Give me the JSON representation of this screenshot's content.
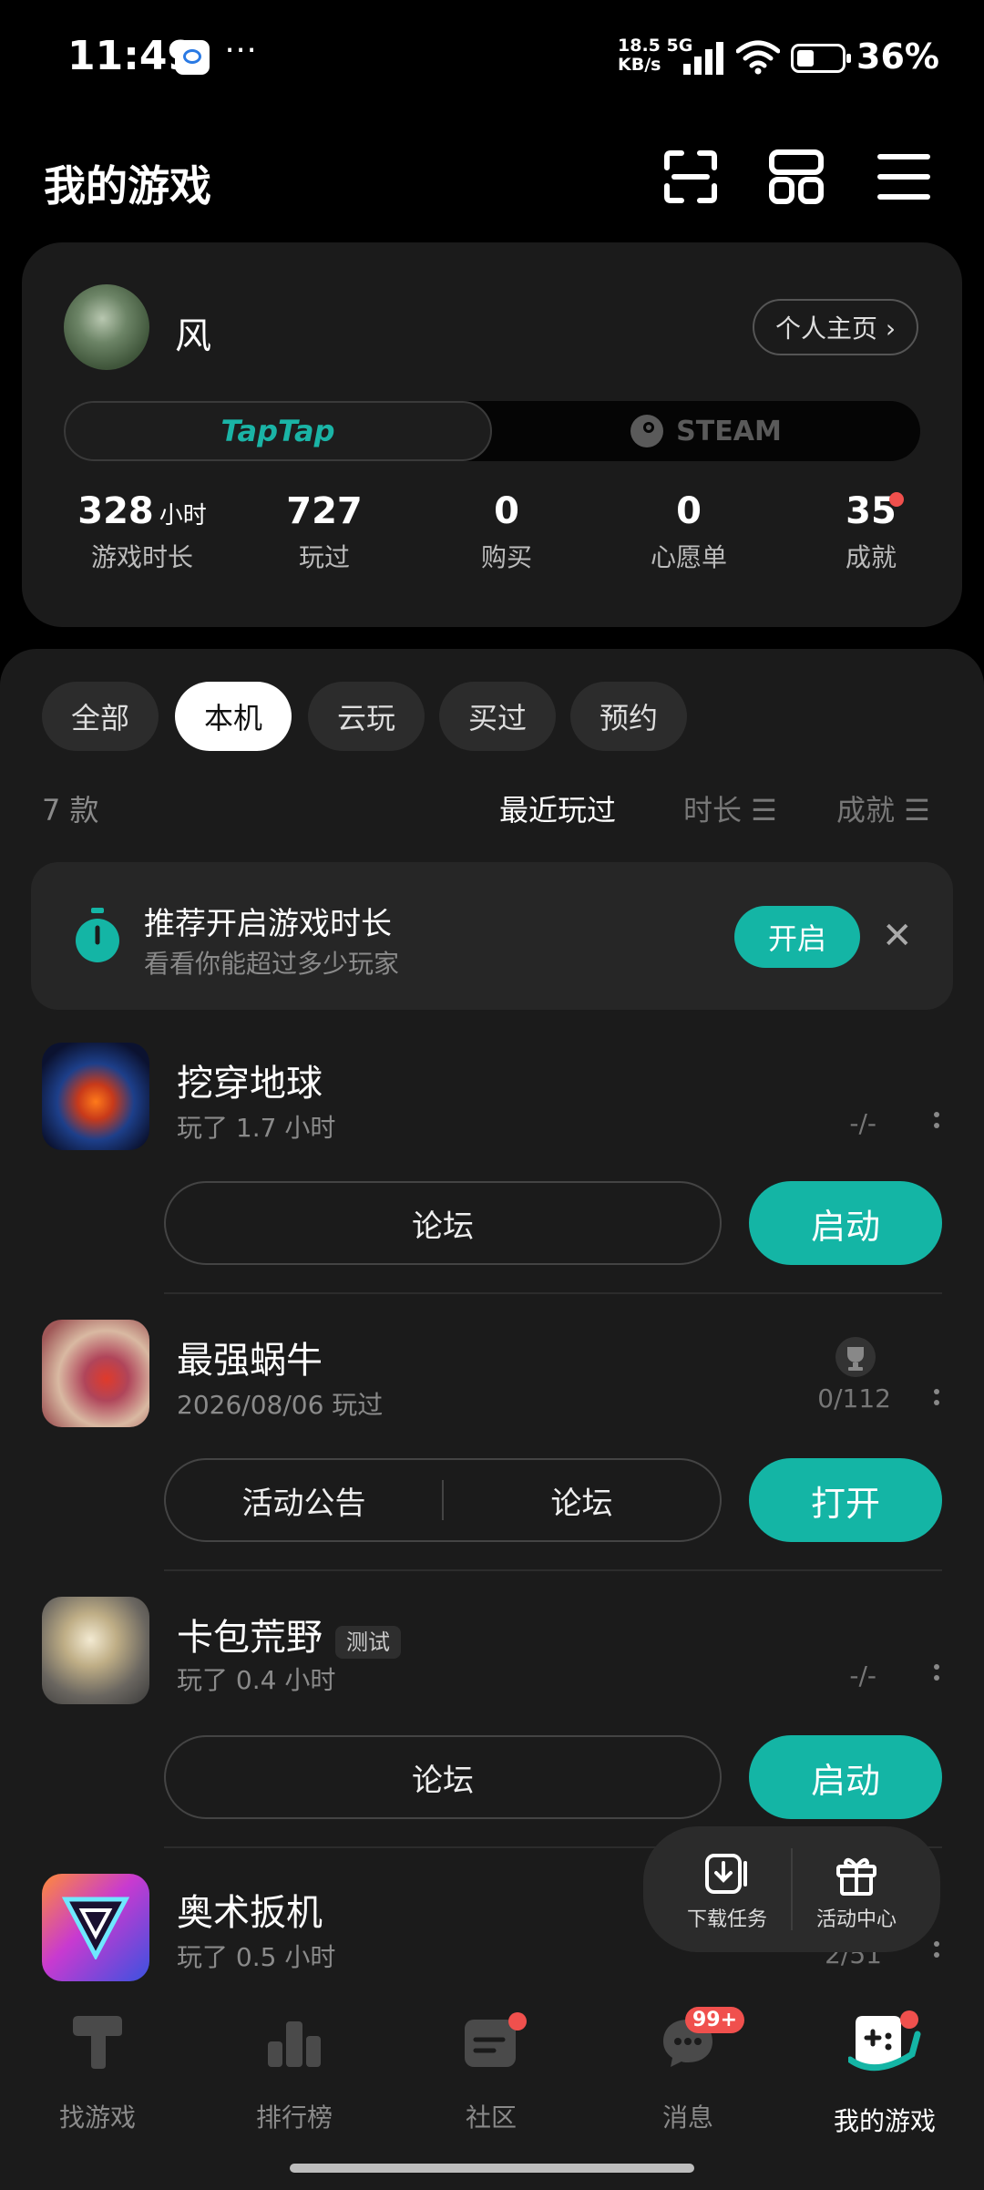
{
  "status_bar": {
    "time": "11:49",
    "net_speed": "18.5",
    "net_unit": "KB/s",
    "net_type": "5G",
    "battery": "36%"
  },
  "header": {
    "title": "我的游戏",
    "icons": [
      "scan-icon",
      "grid-icon",
      "menu-icon"
    ]
  },
  "profile": {
    "username": "风",
    "home_button": "个人主页 ›",
    "platforms": [
      "TapTap",
      "STEAM"
    ],
    "stats": [
      {
        "value": "328",
        "unit": "小时",
        "label": "游戏时长"
      },
      {
        "value": "727",
        "unit": "",
        "label": "玩过"
      },
      {
        "value": "0",
        "unit": "",
        "label": "购买"
      },
      {
        "value": "0",
        "unit": "",
        "label": "心愿单"
      },
      {
        "value": "35",
        "unit": "",
        "label": "成就"
      }
    ]
  },
  "filters": [
    "全部",
    "本机",
    "云玩",
    "买过",
    "预约"
  ],
  "active_filter": "本机",
  "list": {
    "count": "7 款",
    "sort_options": [
      "最近玩过",
      "时长 ☰",
      "成就 ☰"
    ]
  },
  "recommend": {
    "title": "推荐开启游戏时长",
    "subtitle": "看看你能超过多少玩家",
    "button": "开启",
    "close": "✕"
  },
  "games": [
    {
      "name": "挖穿地球",
      "sub": "玩了 1.7 小时",
      "stat": "-/-",
      "buttons": [
        "论坛"
      ],
      "action": "启动",
      "tag": ""
    },
    {
      "name": "最强蜗牛",
      "sub": "2026/08/06 玩过",
      "stat": "0/112",
      "buttons": [
        "活动公告",
        "论坛"
      ],
      "action": "打开",
      "tag": ""
    },
    {
      "name": "卡包荒野",
      "sub": "玩了 0.4 小时",
      "stat": "-/-",
      "buttons": [
        "论坛"
      ],
      "action": "启动",
      "tag": "测试"
    },
    {
      "name": "奥术扳机",
      "sub": "玩了 0.5 小时",
      "stat": "2/51",
      "buttons": [],
      "action": "",
      "tag": ""
    }
  ],
  "floating": {
    "download": "下载任务",
    "events": "活动中心"
  },
  "nav": [
    {
      "label": "找游戏",
      "badge": ""
    },
    {
      "label": "排行榜",
      "badge": ""
    },
    {
      "label": "社区",
      "badge": ""
    },
    {
      "label": "消息",
      "badge": "99+"
    },
    {
      "label": "我的游戏",
      "badge": ""
    }
  ],
  "colors": {
    "accent": "#14b5a5",
    "badge": "#f0504d",
    "background": "#000000",
    "card": "#1b1b1b"
  }
}
